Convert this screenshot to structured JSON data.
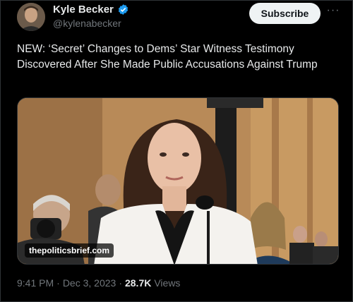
{
  "author": {
    "display_name": "Kyle Becker",
    "handle": "@kylenabecker",
    "verified": true,
    "avatar_icon": "profile-avatar"
  },
  "header": {
    "subscribe_label": "Subscribe",
    "more_icon": "more-horizontal-icon"
  },
  "tweet": {
    "text": "NEW: ‘Secret’ Changes to Dems’ Star Witness Testimony Discovered After She Made Public Accusations Against Trump"
  },
  "media": {
    "watermark": "thepoliticsbrief.com"
  },
  "meta": {
    "time": "9:41 PM",
    "separator": "·",
    "date": "Dec 3, 2023",
    "separator2": "·",
    "views_count": "28.7K",
    "views_label": "Views"
  },
  "colors": {
    "background": "#000000",
    "text": "#e7e9ea",
    "muted": "#71767b",
    "verified": "#1d9bf0",
    "button_bg": "#eff3f4"
  }
}
